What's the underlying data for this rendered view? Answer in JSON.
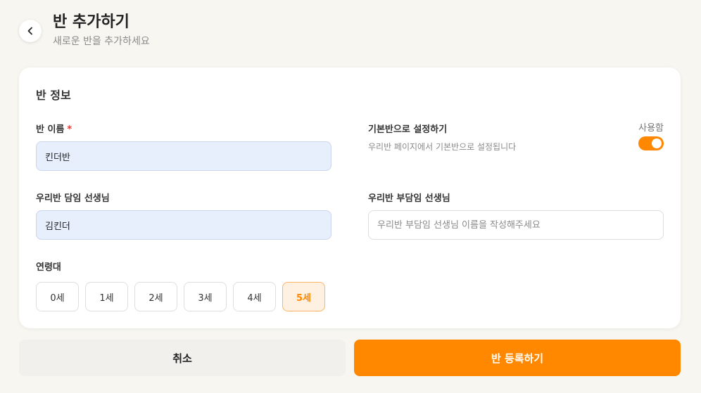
{
  "header": {
    "title": "반 추가하기",
    "subtitle": "새로운 반을 추가하세요"
  },
  "section": {
    "title": "반 정보"
  },
  "class_name": {
    "label": "반 이름",
    "required_mark": "*",
    "value": "킨더반"
  },
  "default_class": {
    "label": "기본반으로 설정하기",
    "description": "우리반 페이지에서 기본반으로 설정됩니다",
    "toggle_label": "사용함",
    "enabled": true
  },
  "homeroom_teacher": {
    "label": "우리반 담임 선생님",
    "value": "김킨더"
  },
  "assistant_teacher": {
    "label": "우리반 부담임 선생님",
    "value": "",
    "placeholder": "우리반 부담임 선생님 이름을 작성해주세요"
  },
  "age_group": {
    "label": "연령대",
    "options": [
      "0세",
      "1세",
      "2세",
      "3세",
      "4세",
      "5세"
    ],
    "selected": "5세"
  },
  "footer": {
    "cancel_label": "취소",
    "submit_label": "반 등록하기"
  },
  "colors": {
    "accent": "#ff8800",
    "filled_input_bg": "#e8effc",
    "required": "#e53935"
  },
  "icons": {
    "back": "chevron-left-icon"
  }
}
